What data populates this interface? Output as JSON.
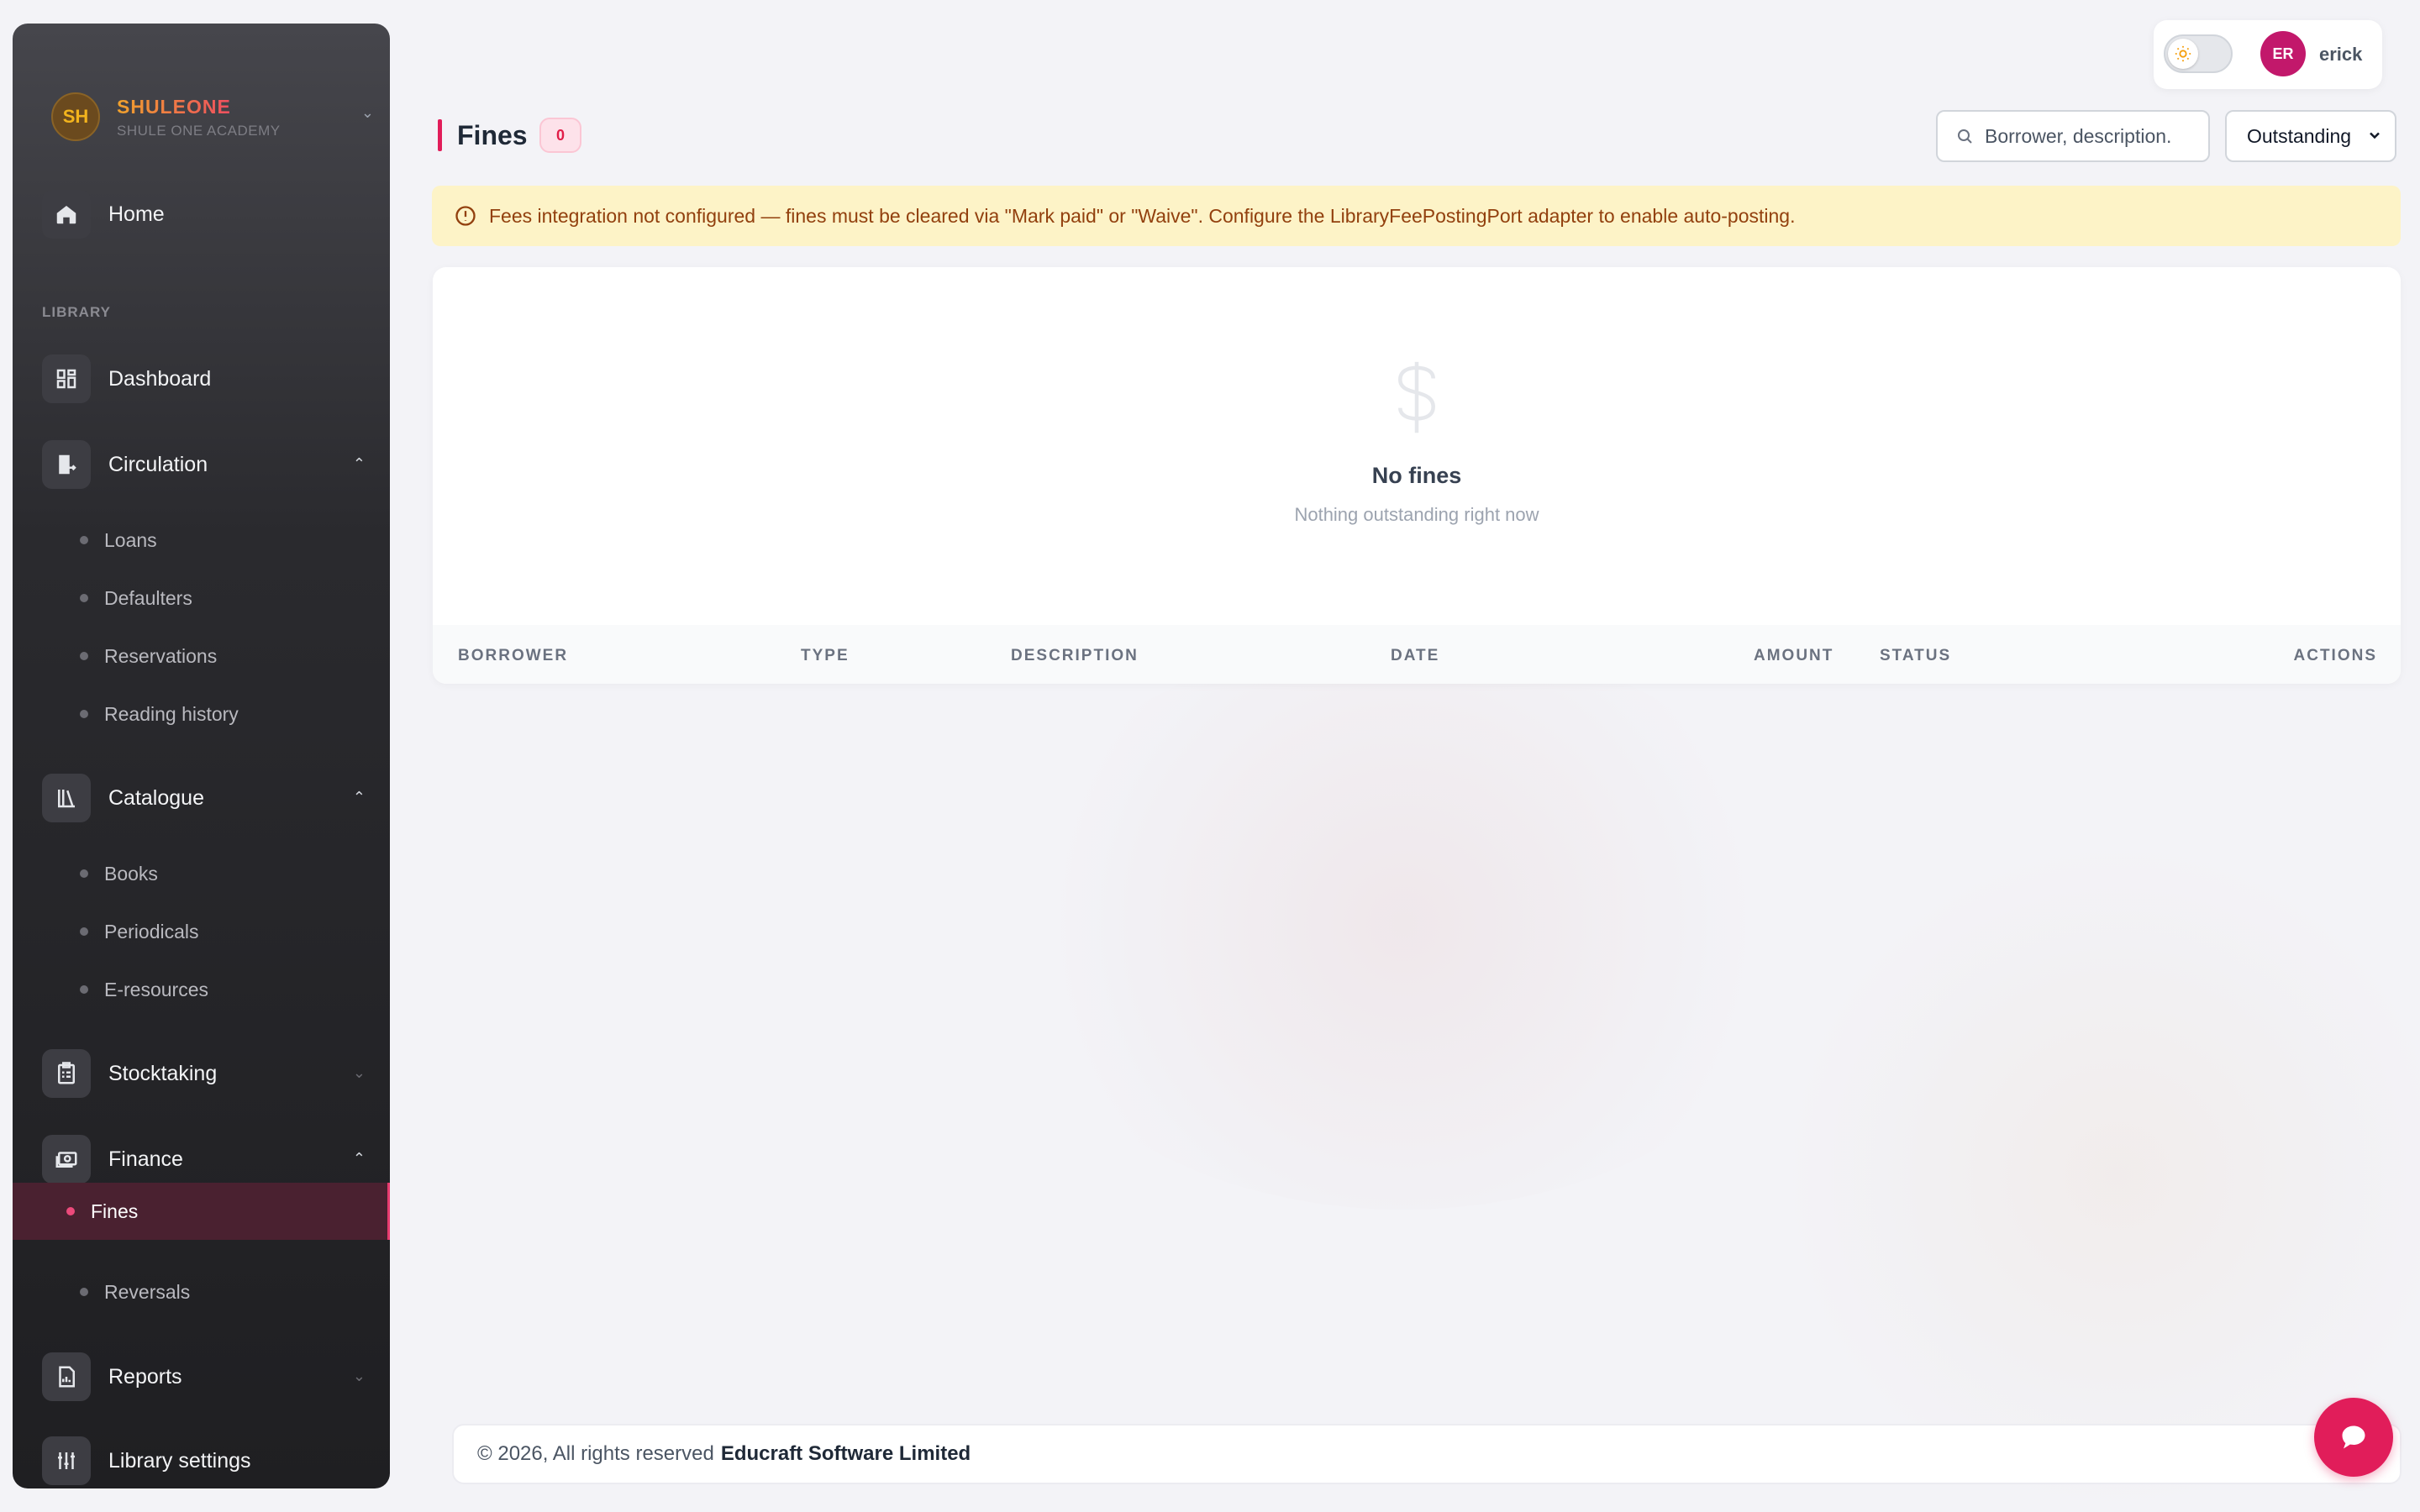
{
  "brand": {
    "initials": "SH",
    "name": "SHULEONE",
    "subtitle": "SHULE ONE ACADEMY"
  },
  "sidebar": {
    "home": "Home",
    "section_library": "LIBRARY",
    "dashboard": "Dashboard",
    "circulation": {
      "label": "Circulation",
      "items": [
        "Loans",
        "Defaulters",
        "Reservations",
        "Reading history"
      ]
    },
    "catalogue": {
      "label": "Catalogue",
      "items": [
        "Books",
        "Periodicals",
        "E-resources"
      ]
    },
    "stocktaking": "Stocktaking",
    "finance": {
      "label": "Finance",
      "items": [
        "Fines",
        "Reversals"
      ]
    },
    "reports": "Reports",
    "library_settings": "Library settings"
  },
  "user": {
    "initials": "ER",
    "name": "erick"
  },
  "page": {
    "title": "Fines",
    "count": "0",
    "search_placeholder": "Borrower, description.",
    "filter_value": "Outstanding"
  },
  "alert": {
    "text": "Fees integration not configured — fines must be cleared via \"Mark paid\" or \"Waive\". Configure the LibraryFeePostingPort adapter to enable auto-posting."
  },
  "empty": {
    "title": "No fines",
    "subtitle": "Nothing outstanding right now"
  },
  "table": {
    "columns": [
      "BORROWER",
      "TYPE",
      "DESCRIPTION",
      "DATE",
      "AMOUNT",
      "STATUS",
      "ACTIONS"
    ]
  },
  "footer": {
    "text": "© 2026, All rights reserved",
    "company": "Educraft Software Limited"
  },
  "colors": {
    "accent": "#e11d5a",
    "sidebar_bg": "#1f1f22",
    "alert_bg": "#fdf3c7"
  }
}
